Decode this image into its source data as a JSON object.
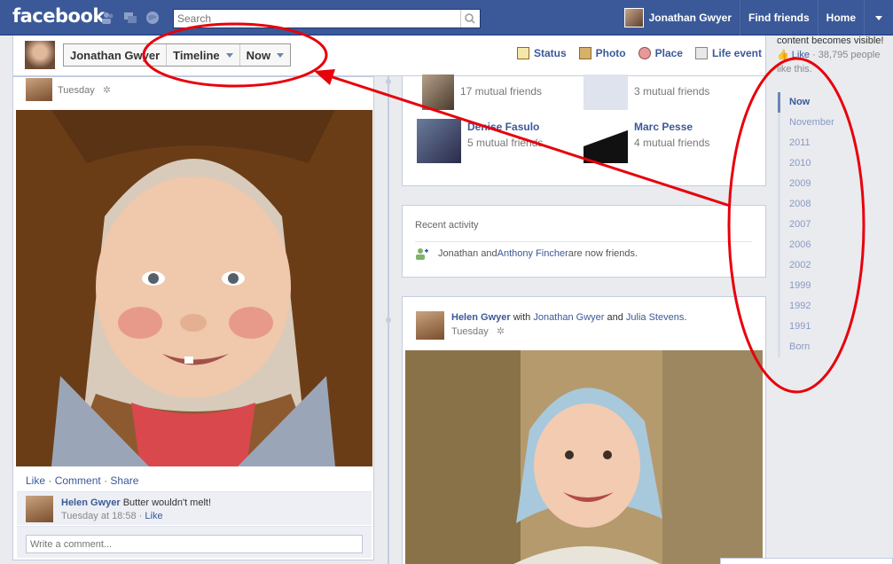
{
  "header": {
    "logo": "facebook",
    "search_placeholder": "Search",
    "user_name": "Jonathan Gwyer",
    "find_friends": "Find friends",
    "home": "Home"
  },
  "profile_bar": {
    "name": "Jonathan Gwyer",
    "view": "Timeline",
    "period": "Now",
    "actions": [
      "Status",
      "Photo",
      "Place",
      "Life event"
    ]
  },
  "left_post": {
    "date": "Tuesday",
    "actions": [
      "Like",
      "Comment",
      "Share"
    ],
    "comment": {
      "author": "Helen Gwyer",
      "text": "Butter wouldn't melt!",
      "time": "Tuesday at 18:58",
      "like": "Like"
    },
    "comment_placeholder": "Write a comment..."
  },
  "friends": [
    {
      "name": "",
      "sub": "17 mutual friends"
    },
    {
      "name": "",
      "sub": "3 mutual friends"
    },
    {
      "name": "Denise Fasulo",
      "sub": "5 mutual friends"
    },
    {
      "name": "Marc Pesse",
      "sub": "4 mutual friends"
    }
  ],
  "activity": {
    "title": "Recent activity",
    "pre": "Jonathan and ",
    "link": "Anthony Fincher",
    "post": " are now friends."
  },
  "right_post": {
    "author": "Helen Gwyer",
    "with_word": " with ",
    "tag1": "Jonathan Gwyer",
    "and_word": " and ",
    "tag2": "Julia Stevens",
    "dot": ".",
    "date": "Tuesday"
  },
  "rail": {
    "promo": "content becomes visible!",
    "like": "Like",
    "people": "· 38,795 people like this.",
    "years": [
      "Now",
      "November",
      "2011",
      "2010",
      "2009",
      "2008",
      "2007",
      "2006",
      "2002",
      "1999",
      "1992",
      "1991",
      "Born"
    ]
  },
  "colors": {
    "brand": "#3b5998",
    "annotation": "#e8000b"
  }
}
